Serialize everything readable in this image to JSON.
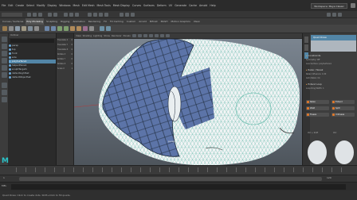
{
  "menu": {
    "items": [
      "File",
      "Edit",
      "Create",
      "Select",
      "Modify",
      "Display",
      "Windows",
      "Mesh",
      "Edit Mesh",
      "Mesh Tools",
      "Mesh Display",
      "Curves",
      "Surfaces",
      "Deform",
      "UV",
      "Generate",
      "Cache",
      "Arnold",
      "Help"
    ],
    "workspace": "Workspace: Maya Classic"
  },
  "shelf": {
    "tabs": [
      "Curves / Surfaces",
      "Poly Modeling",
      "Sculpting",
      "Rigging",
      "Animation",
      "Rendering",
      "FX",
      "FX Caching",
      "Custom",
      "Arnold",
      "Bifrost",
      "MASH",
      "Motion Graphics",
      "XGen"
    ],
    "active_tab": "Poly Modeling"
  },
  "outliner": {
    "title": "Outliner",
    "rows": [
      "persp",
      "top",
      "front",
      "side",
      "polySurface1",
      "helperPlane1",
      "sculptTarget1",
      "defaultLightSet",
      "defaultObjectSet"
    ],
    "selected_index": 4
  },
  "channel_box": {
    "rows": [
      {
        "name": "Translate X",
        "value": "0"
      },
      {
        "name": "Translate Y",
        "value": "0"
      },
      {
        "name": "Translate Z",
        "value": "0"
      },
      {
        "name": "Rotate X",
        "value": "0"
      },
      {
        "name": "Rotate Y",
        "value": "0"
      },
      {
        "name": "Rotate Z",
        "value": "0"
      },
      {
        "name": "Scale X",
        "value": "1"
      }
    ]
  },
  "viewport": {
    "panel_menus": [
      "View",
      "Shading",
      "Lighting",
      "Show",
      "Renderer",
      "Panels"
    ],
    "camera_label": "persp",
    "colors": {
      "mesh": "#f2f4f5",
      "wire": "#5fb8a8",
      "retopo": "#5c74a8",
      "retopo_edge": "#1e2a3a"
    }
  },
  "right_panel": {
    "header": "Quad Draw",
    "sections": [
      {
        "label": "Constraints",
        "lines": [
          "Symmetry: Off",
          "Live Surface: polySurface1"
        ]
      },
      {
        "label": "Relax / Tweak",
        "lines": [
          "Relax Influence: 1.00",
          "Auto Relax: On"
        ]
      },
      {
        "label": "Extend Loop",
        "lines": [
          "Loop Ring Width: 1"
        ]
      }
    ],
    "buttons": [
      "Relax",
      "Extend",
      "Weld",
      "Split",
      "Freeze",
      "Unfreeze"
    ],
    "hotkeys": [
      "Ctrl + Shift",
      "Ctrl"
    ]
  },
  "timeline": {
    "start": "1",
    "end": "120"
  },
  "cmdline": {
    "label": "MEL"
  },
  "help": {
    "text": "Quad Draw: Click to create dots. Shift+Click to fill quads."
  }
}
